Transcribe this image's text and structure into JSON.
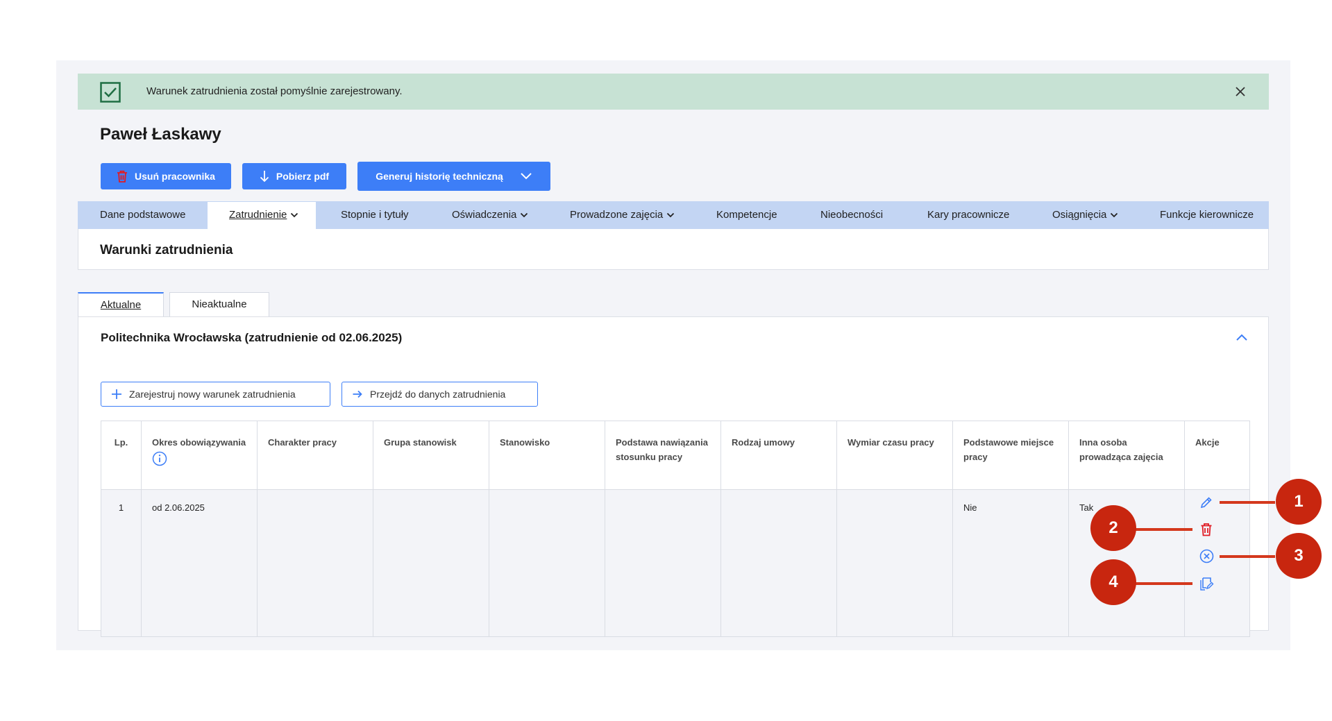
{
  "alert": {
    "message": "Warunek zatrudnienia został pomyślnie zarejestrowany."
  },
  "page": {
    "title": "Paweł Łaskawy"
  },
  "toolbar": {
    "delete_label": "Usuń pracownika",
    "pdf_label": "Pobierz pdf",
    "history_label": "Generuj historię techniczną"
  },
  "nav": {
    "items": [
      {
        "label": "Dane podstawowe"
      },
      {
        "label": "Zatrudnienie"
      },
      {
        "label": "Stopnie i tytuły"
      },
      {
        "label": "Oświadczenia"
      },
      {
        "label": "Prowadzone zajęcia"
      },
      {
        "label": "Kompetencje"
      },
      {
        "label": "Nieobecności"
      },
      {
        "label": "Kary pracownicze"
      },
      {
        "label": "Osiągnięcia"
      },
      {
        "label": "Funkcje kierownicze"
      }
    ],
    "active": "Zatrudnienie"
  },
  "section": {
    "title": "Warunki zatrudnienia"
  },
  "tabs": [
    {
      "label": "Aktualne"
    },
    {
      "label": "Nieaktualne"
    }
  ],
  "panel": {
    "title": "Politechnika Wrocławska (zatrudnienie od 02.06.2025)",
    "register_label": "Zarejestruj nowy warunek zatrudnienia",
    "goto_label": "Przejdź do danych zatrudnienia"
  },
  "table": {
    "headers": [
      "Lp.",
      "Okres obowiązywania",
      "Charakter pracy",
      "Grupa stanowisk",
      "Stanowisko",
      "Podstawa nawiązania stosunku pracy",
      "Rodzaj umowy",
      "Wymiar czasu pracy",
      "Podstawowe miejsce pracy",
      "Inna osoba prowadząca zajęcia",
      "Akcje"
    ],
    "rows": [
      {
        "lp": "1",
        "okres": "od 2.06.2025",
        "charakter": "",
        "grupa": "",
        "stanowisko": "",
        "podstawa": "",
        "rodzaj": "",
        "wymiar": "",
        "podstawowe": "Nie",
        "inna": "Tak"
      }
    ]
  },
  "callouts": [
    "1",
    "2",
    "3",
    "4"
  ],
  "colors": {
    "accent": "#3d7ef7",
    "alert_bg": "#c7e2d4",
    "nav_bg": "#c3d5f3",
    "danger": "#d4381d",
    "badge": "#c8260f"
  },
  "icons": {
    "alert": "check-square-icon",
    "close": "close-icon",
    "delete": "trash-icon",
    "download": "arrow-down-icon",
    "dropdown": "chevron-down-icon",
    "collapse": "chevron-up-icon",
    "add": "plus-icon",
    "goto": "arrow-right-icon",
    "info": "info-icon",
    "edit": "pencil-icon",
    "cancel": "cancel-circle-icon",
    "copy": "copy-edit-icon"
  }
}
